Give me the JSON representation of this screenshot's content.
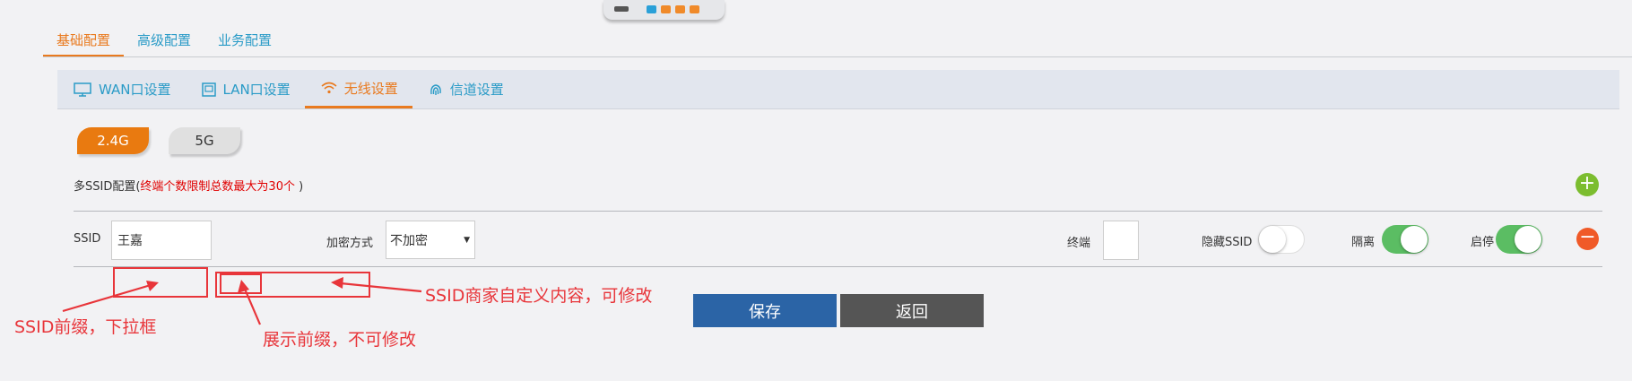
{
  "main_tabs": [
    {
      "label": "基础配置",
      "active": true
    },
    {
      "label": "高级配置",
      "active": false
    },
    {
      "label": "业务配置",
      "active": false
    }
  ],
  "sub_tabs": [
    {
      "label": "WAN口设置",
      "icon": "monitor-icon",
      "active": false
    },
    {
      "label": "LAN口设置",
      "icon": "lan-icon",
      "active": false
    },
    {
      "label": "无线设置",
      "icon": "wifi-icon",
      "active": true
    },
    {
      "label": "信道设置",
      "icon": "fingerprint-icon",
      "active": false
    }
  ],
  "bands": [
    {
      "label": "2.4G",
      "active": true
    },
    {
      "label": "5G",
      "active": false
    }
  ],
  "multi_ssid": {
    "prefix": "多SSID配置(",
    "limit_text": "终端个数限制总数最大为30个",
    "suffix": "  )"
  },
  "row": {
    "ssid_label": "SSID",
    "ssid_value": "王嘉",
    "encryption_label": "加密方式",
    "encryption_value": "不加密",
    "terminal_label": "终端",
    "hide_ssid_label": "隐藏SSID",
    "hide_ssid_on": false,
    "isolate_label": "隔离",
    "isolate_on": true,
    "enable_label": "启停",
    "enable_on": true
  },
  "annotations": {
    "prefix_note": "SSID前缀，下拉框",
    "display_note": "展示前缀，不可修改",
    "custom_note": "SSID商家自定义内容，可修改"
  },
  "buttons": {
    "save": "保存",
    "back": "返回"
  },
  "colors": {
    "accent_orange": "#e97a1f",
    "link_blue": "#2a9bc7",
    "save_blue": "#2b64a6",
    "toggle_green": "#5bbd63",
    "annotation_red": "#e8353a"
  }
}
